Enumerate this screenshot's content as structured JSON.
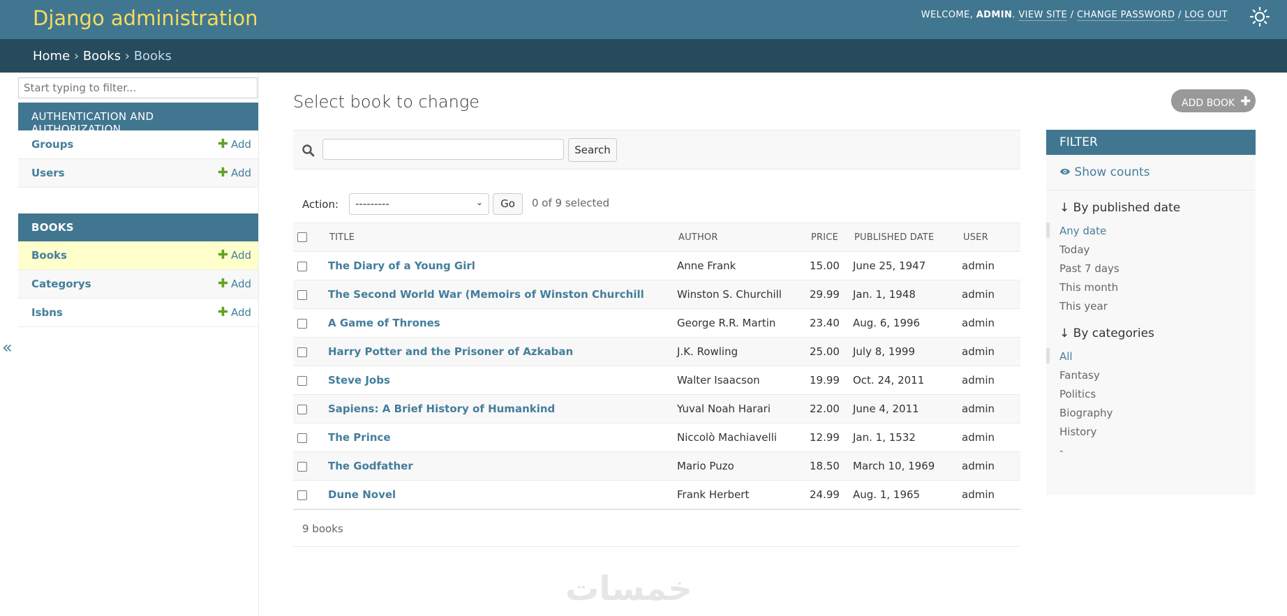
{
  "header": {
    "branding": "Django administration",
    "welcome": "Welcome,",
    "username": "admin",
    "view_site": "View site",
    "change_password": "Change password",
    "log_out": "Log out",
    "sep": "/"
  },
  "breadcrumbs": {
    "home": "Home",
    "app": "Books",
    "current": "Books",
    "sep": "›"
  },
  "sidebar": {
    "filter_placeholder": "Start typing to filter...",
    "modules": [
      {
        "caption": "Authentication and Authorization",
        "models": [
          {
            "name": "Groups",
            "add": "Add"
          },
          {
            "name": "Users",
            "add": "Add"
          }
        ]
      },
      {
        "caption": "Books",
        "models": [
          {
            "name": "Books",
            "add": "Add"
          },
          {
            "name": "Categorys",
            "add": "Add"
          },
          {
            "name": "Isbns",
            "add": "Add"
          }
        ]
      }
    ],
    "collapse_glyph": "«"
  },
  "main": {
    "title": "Select book to change",
    "add_button": "Add book",
    "search_button": "Search",
    "search_value": "",
    "action_label": "Action:",
    "action_value": "---------",
    "go_button": "Go",
    "selection_counter": "0 of 9 selected",
    "columns": [
      "Title",
      "Author",
      "Price",
      "Published date",
      "User"
    ],
    "rows": [
      {
        "title": "The Diary of a Young Girl",
        "author": "Anne Frank",
        "price": "15.00",
        "published": "June 25, 1947",
        "user": "admin"
      },
      {
        "title": "The Second World War (Memoirs of Winston Churchill",
        "author": "Winston S. Churchill",
        "price": "29.99",
        "published": "Jan. 1, 1948",
        "user": "admin"
      },
      {
        "title": "A Game of Thrones",
        "author": "George R.R. Martin",
        "price": "23.40",
        "published": "Aug. 6, 1996",
        "user": "admin"
      },
      {
        "title": "Harry Potter and the Prisoner of Azkaban",
        "author": "J.K. Rowling",
        "price": "25.00",
        "published": "July 8, 1999",
        "user": "admin"
      },
      {
        "title": "Steve Jobs",
        "author": "Walter Isaacson",
        "price": "19.99",
        "published": "Oct. 24, 2011",
        "user": "admin"
      },
      {
        "title": "Sapiens: A Brief History of Humankind",
        "author": "Yuval Noah Harari",
        "price": "22.00",
        "published": "June 4, 2011",
        "user": "admin"
      },
      {
        "title": "The Prince",
        "author": "Niccolò Machiavelli",
        "price": "12.99",
        "published": "Jan. 1, 1532",
        "user": "admin"
      },
      {
        "title": "The Godfather",
        "author": "Mario Puzo",
        "price": "18.50",
        "published": "March 10, 1969",
        "user": "admin"
      },
      {
        "title": "Dune Novel",
        "author": "Frank Herbert",
        "price": "24.99",
        "published": "Aug. 1, 1965",
        "user": "admin"
      }
    ],
    "paginator": "9 books"
  },
  "filter": {
    "heading": "Filter",
    "show_counts": "Show counts",
    "groups": [
      {
        "title": "By published date",
        "options": [
          "Any date",
          "Today",
          "Past 7 days",
          "This month",
          "This year"
        ],
        "selected": 0
      },
      {
        "title": "By categories",
        "options": [
          "All",
          "Fantasy",
          "Politics",
          "Biography",
          "History",
          "-"
        ],
        "selected": 0
      }
    ]
  },
  "watermark": "خمسات",
  "colors": {
    "header_bg": "#417690",
    "branding": "#f5dd5d",
    "breadcrumbs_bg": "#264b5d",
    "link": "#447e9b",
    "add_green": "#5fa225",
    "current_row": "#ffffcc"
  },
  "icons": {
    "theme": "sun-icon",
    "search": "magnifier-icon",
    "add": "plus-icon",
    "show_counts": "eye-icon",
    "filter_sort": "down-arrow-icon"
  }
}
